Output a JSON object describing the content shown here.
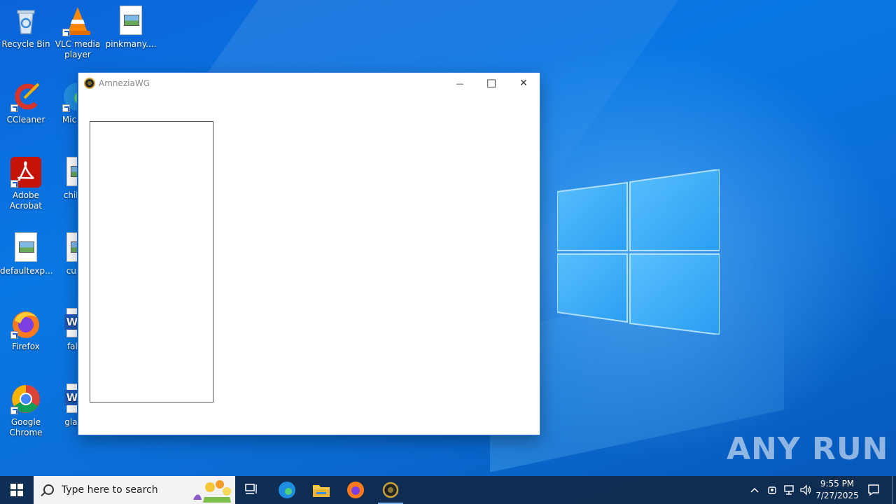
{
  "desktop": {
    "icons": [
      {
        "label": "Recycle Bin"
      },
      {
        "label": "VLC media player"
      },
      {
        "label": "pinkmany...."
      },
      {
        "label": "CCleaner"
      },
      {
        "label": "Micr Ed"
      },
      {
        "label": "Adobe Acrobat"
      },
      {
        "label": "childre"
      },
      {
        "label": "defaultexp..."
      },
      {
        "label": "custo"
      },
      {
        "label": "Firefox"
      },
      {
        "label": "fallfu"
      },
      {
        "label": "Google Chrome"
      },
      {
        "label": "glassc"
      }
    ]
  },
  "window": {
    "title": "AmneziaWG",
    "minimize_glyph": "—",
    "maximize_glyph": "☐",
    "close_glyph": "✕"
  },
  "taskbar": {
    "search_placeholder": "Type here to search",
    "clock_time": "9:55 PM",
    "clock_date": "7/27/2025"
  },
  "watermark": {
    "text": "ANY RUN"
  },
  "colors": {
    "desktop": "#0a78e4",
    "taskbar": "#10284a",
    "accent": "#7fb2ea"
  }
}
